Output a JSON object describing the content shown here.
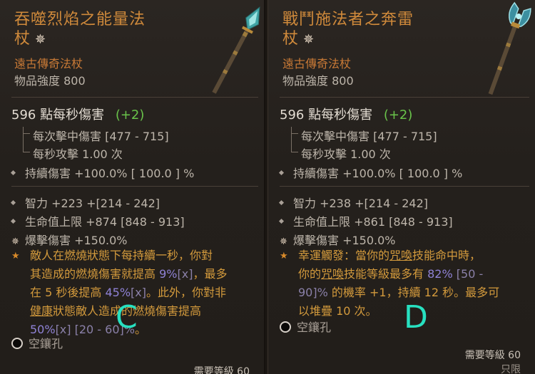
{
  "panel_c": {
    "title_line1": "吞噬烈焰之能量法",
    "title_line2": "杖",
    "title_ornament": "✵",
    "item_type": "遠古傳奇法杖",
    "item_power": "物品強度 800",
    "dps_value": "596 點每秒傷害",
    "dps_delta": "(+2)",
    "dps_delta_sign": "+2",
    "damage_per_hit": "每次擊中傷害 [477 - 715]",
    "attacks_per_second": "每秒攻擊 1.00 次",
    "dot_damage": "持續傷害 +100.0%  [ 100.0 ] %",
    "stat_int": "智力 +223 +[214 - 242]",
    "stat_life": "生命值上限 +874 [848 - 913]",
    "stat_crit": "爆擊傷害 +150.0%",
    "legendary_1": "敵人在燃燒狀態下每持續一秒，你對",
    "legendary_2a": "其造成的燃燒傷害就提高 ",
    "legendary_2b": "9%",
    "legendary_2c": "[x]",
    "legendary_2d": "，最多",
    "legendary_3a": "在 5 秒後提高 ",
    "legendary_3b": "45%",
    "legendary_3c": "[x]",
    "legendary_3d": "。此外，你對非",
    "legendary_4a": "健康",
    "legendary_4b": "狀態敵人造成的燃燒傷害提高",
    "legendary_5a": "50%",
    "legendary_5b": "[x] [20 - 60]%",
    "legendary_5c": "。",
    "socket": "空鑲孔",
    "required_level": "需要等級 60",
    "overlay": "C"
  },
  "panel_d": {
    "title_line1": "戰鬥施法者之奔雷",
    "title_line2": "杖",
    "title_ornament": "✵",
    "item_type": "遠古傳奇法杖",
    "item_power": "物品強度 800",
    "dps_value": "596 點每秒傷害",
    "dps_delta": "(+2)",
    "damage_per_hit": "每次擊中傷害 [477 - 715]",
    "attacks_per_second": "每秒攻擊 1.00 次",
    "dot_damage": "持續傷害 +100.0%  [ 100.0 ] %",
    "stat_int": "智力 +238 +[214 - 242]",
    "stat_life": "生命值上限 +861 [848 - 913]",
    "stat_crit": "爆擊傷害 +150.0%",
    "legendary_1a": "幸運觸發：當你的",
    "legendary_1b": "咒喚",
    "legendary_1c": "技能命中時，",
    "legendary_2a": "你的",
    "legendary_2b": "咒喚",
    "legendary_2c": "技能等級最多有 ",
    "legendary_2d": "82%",
    "legendary_2e": " [50 -",
    "legendary_3a": "90]%",
    "legendary_3b": " 的機率 +1，持續 12 秒。最多可",
    "legendary_4": "以堆疊 10 次。",
    "socket": "空鑲孔",
    "required_level": "需要等級 60",
    "account_bound": "只限",
    "overlay": "D"
  },
  "colors": {
    "legendary_title": "#d08a3b",
    "legendary_text": "#d39a3c",
    "value_highlight": "#8f82d6",
    "dps_delta_green": "#69c34a",
    "overlay_letter": "#27e0c0"
  },
  "icons": {
    "ornament": "ancient-flower-icon",
    "bullet": "diamond-icon",
    "aspect": "star-icon",
    "socket": "empty-socket-icon"
  }
}
